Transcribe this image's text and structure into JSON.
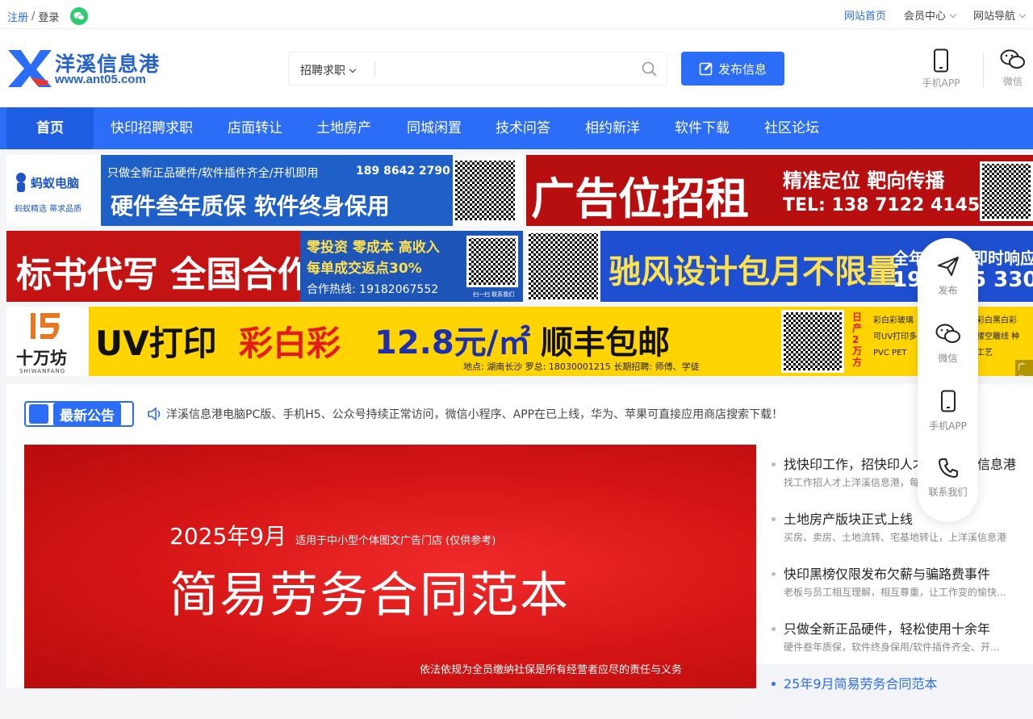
{
  "topbar": {
    "register": "注册",
    "slash": "/",
    "login": "登录",
    "home_link": "网站首页",
    "member_center": "会员中心",
    "site_nav": "网站导航"
  },
  "logo": {
    "name": "洋溪信息港",
    "domain": "www.ant05.com"
  },
  "search": {
    "category": "招聘求职",
    "placeholder": "",
    "publish_label": "发布信息"
  },
  "header_links": {
    "app": "手机APP",
    "wechat": "微信"
  },
  "nav": {
    "items": [
      "首页",
      "快印招聘求职",
      "店面转让",
      "土地房产",
      "同城闲置",
      "技术问答",
      "相约新洋",
      "软件下载",
      "社区论坛"
    ]
  },
  "ads": {
    "ad1": {
      "brand": "蚂蚁电脑",
      "brand_sub": "蚂蚁精选  蒂求品质",
      "line1": "只做全新正品硬件/软件插件齐全/开机即用",
      "phone": "189 8642 2790",
      "slogan": "硬件叁年质保  软件终身保用"
    },
    "ad2": {
      "title": "广告位招租",
      "tagline": "精准定位  靶向传播",
      "phone": "TEL: 138 7122 4145"
    },
    "ad3": {
      "title": "标书代写 全国合作",
      "line1": "零投资 零成本 高收入",
      "line2": "每单成交返点30%",
      "hotline": "合作热线: 19182067552",
      "qr_caption": "扫一扫  联系我们"
    },
    "ad4": {
      "title": "驰风设计包月不限量",
      "right1": "全年",
      "right2": "即时响应",
      "phone_start": "19",
      "phone_end": "5 3305"
    },
    "ad5": {
      "brand": "十万坊",
      "brand_en": "SHIWANFANG",
      "headline_a": "UV打印",
      "headline_b": "彩白彩",
      "price": "12.8元/㎡",
      "shipping": "顺丰包邮",
      "footer": "地点: 湖南长沙   罗总: 18030001215   长期招聘: 师傅、学徒",
      "side_label": "日产2万方",
      "side_text": "彩白彩玻璃  可UV打印多  PVC PET",
      "right_text": "彩白黑白彩  楼空雕线  种工艺",
      "ad_tag": "广告"
    }
  },
  "notice": {
    "badge": "最新公告",
    "text": "洋溪信息港电脑PC版、手机H5、公众号持续正常访问，微信小程序、APP在已上线，华为、苹果可直接应用商店搜索下载！"
  },
  "banner": {
    "year": "2025年9月",
    "sub": "适用于中小型个体图文广告门店 (仅供参考)",
    "title": "简易劳务合同范本",
    "foot": "依法依规为全员缴纳社保是所有经营者应尽的责任与义务"
  },
  "news": [
    {
      "title": "找快印工作，招快印人才，上洋溪信息港",
      "desc": "找工作招人才上洋溪信息港，每天都有新化籍"
    },
    {
      "title": "土地房产版块正式上线",
      "desc": "买房、卖房、土地流转、宅基地转让，上洋溪信息港"
    },
    {
      "title": "快印黑榜仅限发布欠薪与骗路费事件",
      "desc": "老板与员工相互理解，相互尊重，让工作变的愉快..."
    },
    {
      "title": "只做全新正品硬件，轻松使用十余年",
      "desc": "硬件叁年质保，软件终身保用/软件插件齐全、开..."
    },
    {
      "title": "25年9月简易劳务合同范本",
      "desc": ""
    }
  ],
  "float": {
    "publish": "发布",
    "wechat": "微信",
    "app": "手机APP",
    "contact": "联系我们"
  },
  "colors": {
    "primary": "#2b6df6",
    "wechat_green": "#2ecc71",
    "banner_red": "#d41414"
  }
}
